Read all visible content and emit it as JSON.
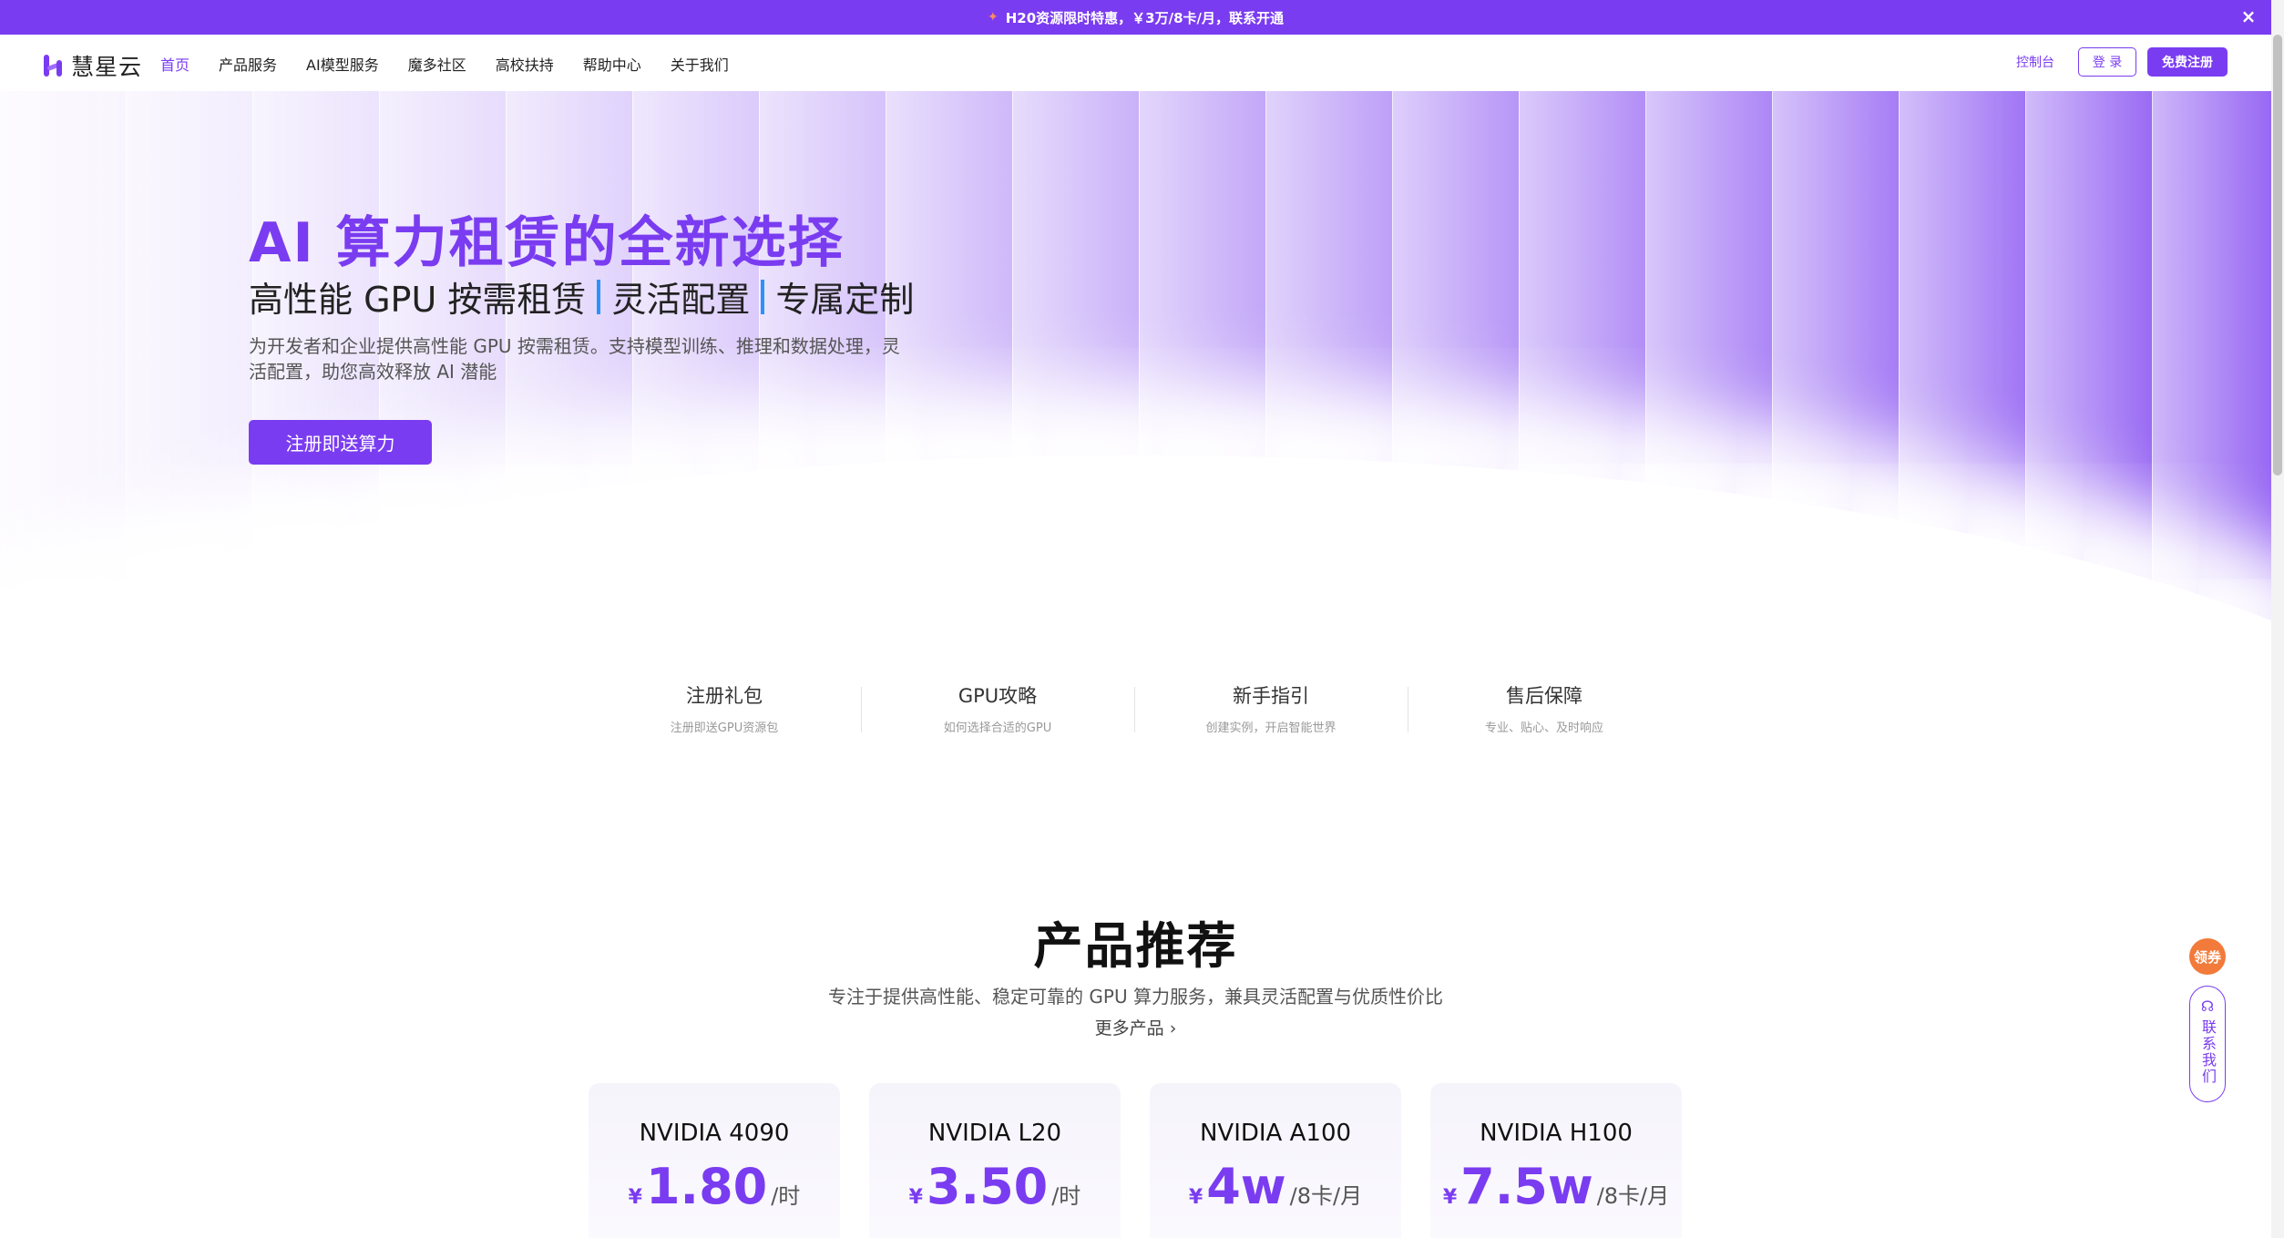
{
  "promo": {
    "text": "H20资源限时特惠，￥3万/8卡/月，联系开通",
    "flag_icon": "party-popper-icon",
    "close": "×"
  },
  "brand": {
    "name": "慧星云",
    "color": "#7a3cf0"
  },
  "nav": {
    "links": [
      "首页",
      "产品服务",
      "AI模型服务",
      "魔多社区",
      "高校扶持",
      "帮助中心",
      "关于我们"
    ],
    "active_index": 0,
    "console": "控制台",
    "login": "登 录",
    "register": "免费注册"
  },
  "hero": {
    "title": "AI 算力租赁的全新选择",
    "subtitle_parts": [
      "高性能 GPU 按需租赁",
      "灵活配置",
      "专属定制"
    ],
    "description": "为开发者和企业提供高性能 GPU 按需租赁。支持模型训练、推理和数据处理，灵活配置，助您高效释放 AI 潜能",
    "cta": "注册即送算力"
  },
  "quick_links": [
    {
      "title": "注册礼包",
      "desc": "注册即送GPU资源包"
    },
    {
      "title": "GPU攻略",
      "desc": "如何选择合适的GPU"
    },
    {
      "title": "新手指引",
      "desc": "创建实例，开启智能世界"
    },
    {
      "title": "售后保障",
      "desc": "专业、贴心、及时响应"
    }
  ],
  "products": {
    "title": "产品推荐",
    "subtitle": "专注于提供高性能、稳定可靠的 GPU 算力服务，兼具灵活配置与优质性价比",
    "more": "更多产品 ›",
    "cards": [
      {
        "name": "NVIDIA 4090",
        "currency": "¥",
        "price": "1.80",
        "unit": "/时"
      },
      {
        "name": "NVIDIA L20",
        "currency": "¥",
        "price": "3.50",
        "unit": "/时"
      },
      {
        "name": "NVIDIA A100",
        "currency": "¥",
        "price": "4w",
        "unit": "/8卡/月"
      },
      {
        "name": "NVIDIA H100",
        "currency": "¥",
        "price": "7.5w",
        "unit": "/8卡/月"
      }
    ]
  },
  "float": {
    "coupon": "领券",
    "contact": "联系我们",
    "contact_icon": "headset-icon"
  }
}
